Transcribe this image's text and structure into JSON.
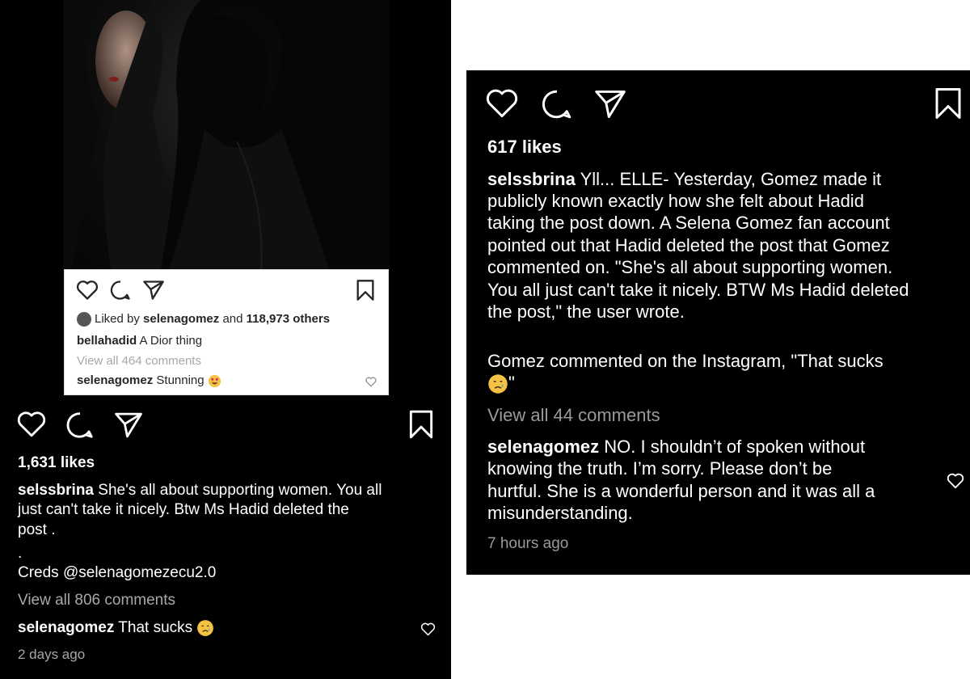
{
  "left_post": {
    "photo_alt": "",
    "embedded_card": {
      "liked_by_prefix": "Liked by",
      "liked_by_user": "selenagomez",
      "liked_by_mid": "and",
      "liked_by_count": "118,973 others",
      "caption_user": "bellahadid",
      "caption_text": "A Dior thing",
      "view_comments": "View all 464 comments",
      "comment_user": "selenagomez",
      "comment_text": "Stunning"
    },
    "likes": "1,631 likes",
    "caption_user": "selssbrina",
    "caption_line1": "She's all about supporting women. You all",
    "caption_line2": "just can't take it nicely. Btw Ms Hadid deleted the",
    "caption_line3": "post .",
    "dot": ".",
    "creds": "Creds @selenagomezecu2.0",
    "view_comments": "View all 806 comments",
    "comment_user": "selenagomez",
    "comment_text": "That sucks",
    "timestamp": "2 days ago"
  },
  "right_post": {
    "likes": "617 likes",
    "caption_user": "selssbrina",
    "caption_lines": [
      "Yll... ELLE- Yesterday, Gomez made it",
      "publicly known exactly how she felt about Hadid",
      "taking the post down. A Selena Gomez fan account",
      "pointed out that Hadid deleted the post that Gomez",
      "commented on. \"She's all about supporting women.",
      "You all just can't take it nicely. BTW Ms Hadid deleted",
      "the post,\" the user wrote."
    ],
    "gomez_line1": "Gomez commented on the Instagram, \"That sucks",
    "gomez_line2": "\"",
    "view_comments": "View all 44 comments",
    "comment_user": "selenagomez",
    "comment_lines": [
      "NO. I shouldn’t of spoken without",
      "knowing the truth. I’m sorry. Please don’t be",
      "hurtful. She is a wonderful person and it was all a",
      "misunderstanding."
    ],
    "timestamp": "7 hours ago"
  },
  "icons": [
    "heart-icon",
    "comment-icon",
    "share-icon",
    "bookmark-icon",
    "crying-face-icon",
    "heart-eyes-icon"
  ]
}
